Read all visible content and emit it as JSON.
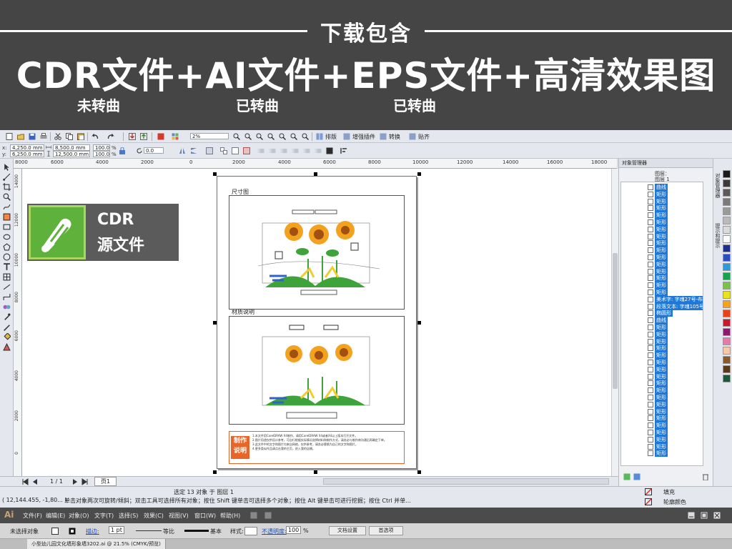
{
  "banner": {
    "header": "下载包含",
    "headline": "CDR文件+AI文件+EPS文件+高清效果图",
    "subs": [
      "未转曲",
      "已转曲",
      "已转曲"
    ]
  },
  "toolbar": {
    "zoom_value": "2%",
    "arrange_label": "排版",
    "plugin_label": "增强插件",
    "convert_label": "转换",
    "paste_label": "贴齐"
  },
  "propbar": {
    "x_label": "x:",
    "x_value": "4,250.0 mm",
    "y_label": "y:",
    "y_value": "6,250.0 mm",
    "w_value": "8,500.0 mm",
    "h_value": "12,500.0 mm",
    "scale_w": "100.0",
    "scale_h": "100.0",
    "pct": "%",
    "angle_value": "0.0"
  },
  "ruler_h": [
    "8000",
    "6000",
    "4000",
    "2000",
    "0",
    "2000",
    "4000",
    "6000",
    "8000",
    "10000",
    "12000",
    "14000",
    "16000",
    "18000"
  ],
  "ruler_v": [
    "14000",
    "12000",
    "10000",
    "8000",
    "6000",
    "4000",
    "2000",
    "0"
  ],
  "logo": {
    "line1": "CDR",
    "line2": "源文件"
  },
  "canvas": {
    "frame1_label": "尺寸图",
    "frame2_label": "材质说明",
    "badge_line1": "制作",
    "badge_line2": "说明",
    "notes": [
      "1.本文件用CorelDRAW X4制作，请用CorelDRAW X4或者X4以上版本打开文件。",
      "2.图片用途仅供设计参考，可自行根据实际情况选择材料和制作方式，请务必与制作商沟通后再确定下单。",
      "3.此文件中的文字和图片均来自网络，仅供参考，请务必替换为自己的文字和图片。",
      "4.更多类似作品请点击我的主页，进入我的店铺。"
    ]
  },
  "hbar": {
    "page_count": "1 / 1",
    "page_tab": "页1"
  },
  "status": {
    "selection": "选定 13 对象 于 图层 1",
    "coords": "( 12,144.455, -1,80... )",
    "hint": "单击对象两次可旋转/倾斜；双击工具可选择所有对象；按住 Shift 键单击可选择多个对象；按住 Alt 键单击可进行挖掘；按住 Ctrl 并单...",
    "fill_label": "填充",
    "outline_label": "轮廓颜色"
  },
  "docker": {
    "title": "对象管理器",
    "layer_label": "图层：",
    "layer_name": "图层 1",
    "tabs": [
      "对象管理器",
      "提示和提示"
    ],
    "items": [
      "曲线",
      "矩形",
      "矩形",
      "矩形",
      "矩形",
      "矩形",
      "矩形",
      "矩形",
      "矩形",
      "矩形",
      "矩形",
      "矩形",
      "矩形",
      "矩形",
      "矩形",
      "矩形",
      "美术字: 字魂27号-布",
      "段落文本: 字魂105号",
      "椭圆形",
      "曲线",
      "矩形",
      "矩形",
      "矩形",
      "矩形",
      "矩形",
      "矩形",
      "矩形",
      "矩形",
      "矩形",
      "矩形",
      "矩形",
      "矩形",
      "矩形",
      "矩形",
      "矩形",
      "矩形",
      "矩形",
      "矩形",
      "矩形"
    ]
  },
  "palette": [
    "#1a1a1a",
    "#3a3a3a",
    "#5a5a5a",
    "#7a7a7a",
    "#9a9a9a",
    "#bababa",
    "#dadada",
    "#ffffff",
    "#1f2f8f",
    "#2c4fbf",
    "#2a9ad8",
    "#1aa04a",
    "#7cc242",
    "#e8e21a",
    "#f6a21a",
    "#e8421a",
    "#c8182a",
    "#8a1a6a",
    "#e87aa8",
    "#f6c8a8",
    "#8a5a2a",
    "#5a3a1a",
    "#1a5a3a"
  ],
  "illustrator": {
    "logo": "Ai",
    "menus": [
      "文件(F)",
      "编辑(E)",
      "对象(O)",
      "文字(T)",
      "选择(S)",
      "效果(C)",
      "视图(V)",
      "窗口(W)",
      "帮助(H)"
    ],
    "no_selection": "未选择对象",
    "stroke_label": "描边:",
    "stroke_value": "1 pt",
    "uniform_label": "等比",
    "basic_label": "基本",
    "style_label": "样式:",
    "opacity_label": "不透明度:",
    "opacity_value": "100",
    "opacity_pct": "%",
    "doc_setup": "文档设置",
    "preferences": "首选项",
    "doc_tab": "小型幼儿园文化墙形象墙3202.ai @ 21.5% (CMYK/预览)"
  }
}
